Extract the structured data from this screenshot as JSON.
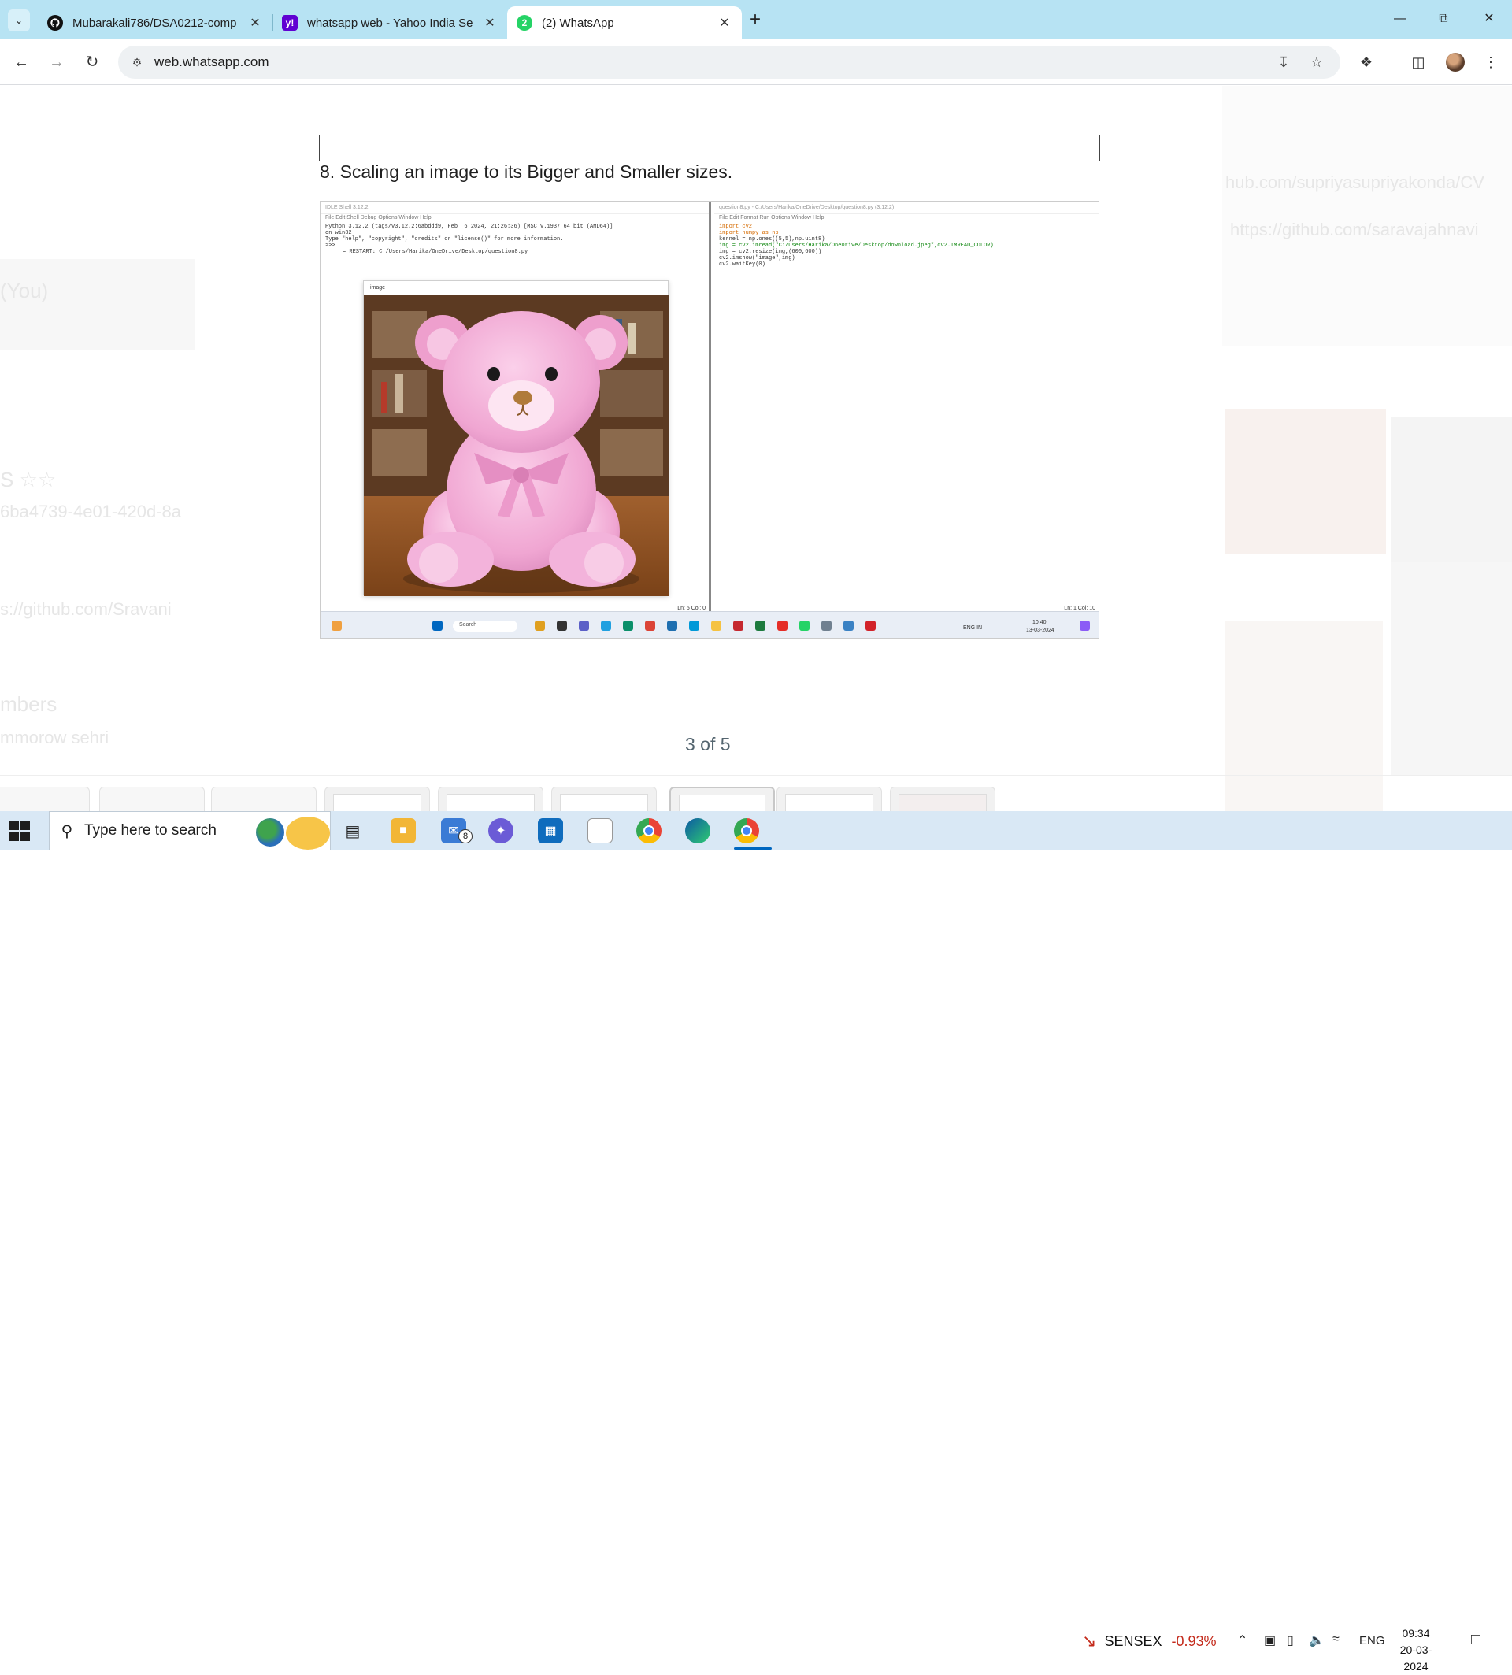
{
  "browser": {
    "tabs": [
      {
        "title": "Mubarakali786/DSA0212-comp",
        "favicon": "github-icon",
        "active": false
      },
      {
        "title": "whatsapp web - Yahoo India Se",
        "favicon": "yahoo-icon",
        "active": false
      },
      {
        "title": "(2) WhatsApp",
        "favicon": "whatsapp-icon",
        "active": true
      }
    ],
    "url": "web.whatsapp.com"
  },
  "viewer": {
    "document_heading": "8. Scaling an image to its Bigger and Smaller sizes.",
    "counter": "3 of 5"
  },
  "screenshot_content": {
    "left_title": "IDLE Shell 3.12.2",
    "left_menu": "File   Edit   Shell   Debug   Options   Window   Help",
    "shell_lines": [
      "Python 3.12.2 (tags/v3.12.2:6abddd9, Feb  6 2024, 21:26:36) [MSC v.1937 64 bit (AMD64)]",
      "on win32",
      "Type \"help\", \"copyright\", \"credits\" or \"license()\" for more information.",
      ">>>",
      "= RESTART: C:/Users/Harika/OneDrive/Desktop/question8.py"
    ],
    "image_window_title": "image",
    "right_title": "question8.py - C:/Users/Harika/OneDrive/Desktop/question8.py (3.12.2)",
    "right_menu": "File   Edit   Format   Run   Options   Window   Help",
    "code_lines": [
      "import cv2",
      "import numpy as np",
      "kernel = np.ones((5,5),np.uint8)",
      "img = cv2.imread(\"C:/Users/Harika/OneDrive/Desktop/download.jpeg\",cv2.IMREAD_COLOR)",
      "img = cv2.resize(img,(600,600))",
      "cv2.imshow(\"image\",img)",
      "cv2.waitKey(0)"
    ],
    "left_status": "Ln: 5   Col: 0",
    "right_status": "Ln: 1   Col: 10",
    "inner_search": "Search",
    "inner_time": "10:40",
    "inner_date": "13-03-2024",
    "inner_lang": "ENG IN"
  },
  "background_faded": {
    "you": "(You)",
    "link1": "hub.com/supriyasupriyakonda/CV",
    "link2": "https://github.com/saravajahnavi",
    "item_s": "S ☆☆",
    "uuid": "6ba4739-4e01-420d-8a",
    "link3": "s://github.com/Sravani",
    "members": "mbers",
    "tomorrow": "mmorow sehri"
  },
  "taskbar": {
    "search_placeholder": "Type here to search",
    "mail_badge": "8",
    "sensex_label": "SENSEX",
    "sensex_change": "-0.93%",
    "language": "ENG",
    "time": "09:34",
    "date": "20-03-2024"
  },
  "colors": {
    "tabstrip": "#b7e3f3",
    "whatsapp_green": "#25d366",
    "sensex_down": "#c42b1c"
  }
}
